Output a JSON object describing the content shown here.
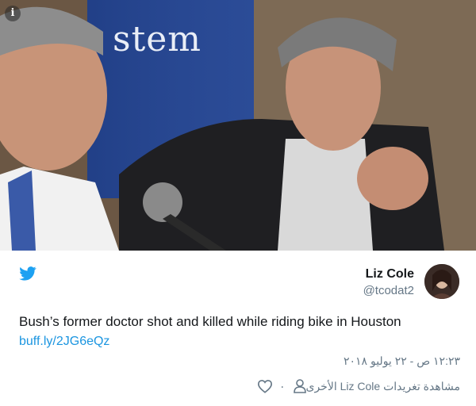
{
  "photo": {
    "banner_text": "stem",
    "info_icon": "info-icon"
  },
  "tweet": {
    "user": {
      "name": "Liz Cole",
      "handle": "@tcodat2"
    },
    "text": "Bush’s former doctor shot and killed while riding bike in Houston",
    "link": "buff.ly/2JG6eQz",
    "timestamp": "١٢:٢٣ ص - ٢٢ يوليو ٢٠١٨",
    "likes": "٠",
    "more_tweets": "مشاهدة تغريدات Liz Cole الأخرى"
  },
  "icons": {
    "brand": "twitter-bird-icon",
    "like": "heart-icon",
    "profile": "person-icon"
  },
  "colors": {
    "twitter_blue": "#1da1f2",
    "link": "#1b95e0",
    "secondary_text": "#657786",
    "primary_text": "#14171a"
  }
}
